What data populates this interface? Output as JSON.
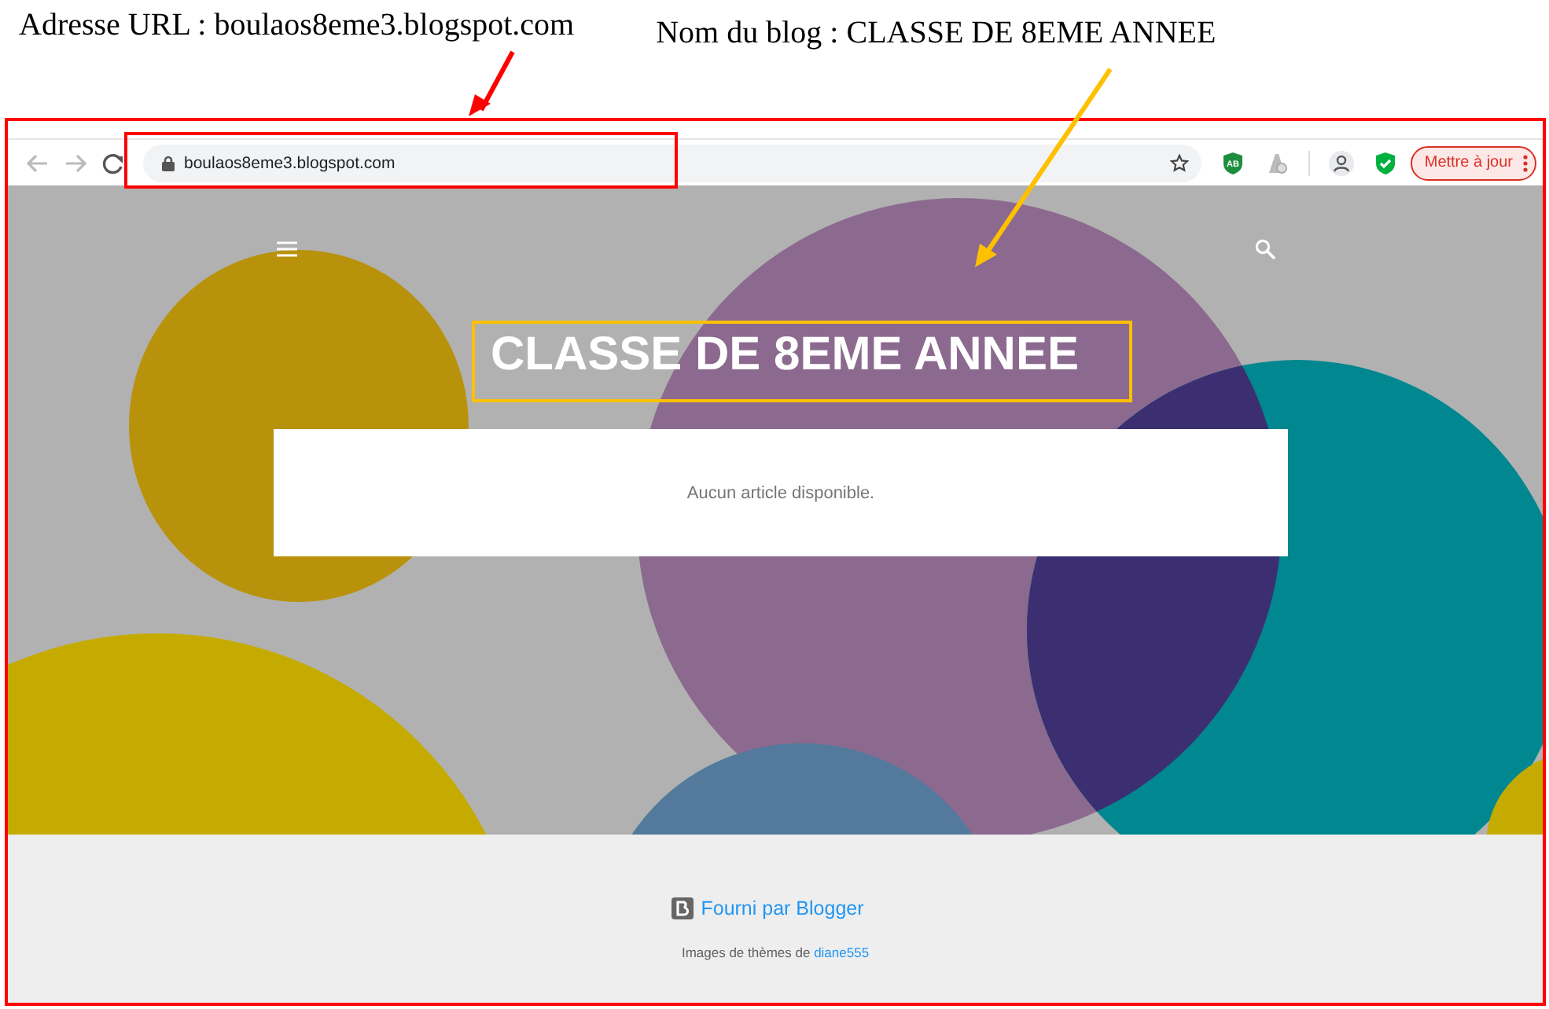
{
  "annotations": [
    {
      "text": "Adresse URL : boulaos8eme3.blogspot.com",
      "color": "#ff0000"
    },
    {
      "text": "Nom du blog : CLASSE DE 8EME ANNEE",
      "color": "#ffc000"
    }
  ],
  "browser": {
    "url": "boulaos8eme3.blogspot.com",
    "extension_badge": "AB",
    "update_button": "Mettre à jour"
  },
  "blog": {
    "title": "CLASSE DE 8EME ANNEE",
    "empty_message": "Aucun article disponible."
  },
  "footer": {
    "powered_by": "Fourni par Blogger",
    "theme_credit": "Images de thèmes de",
    "theme_author": "diane555"
  }
}
